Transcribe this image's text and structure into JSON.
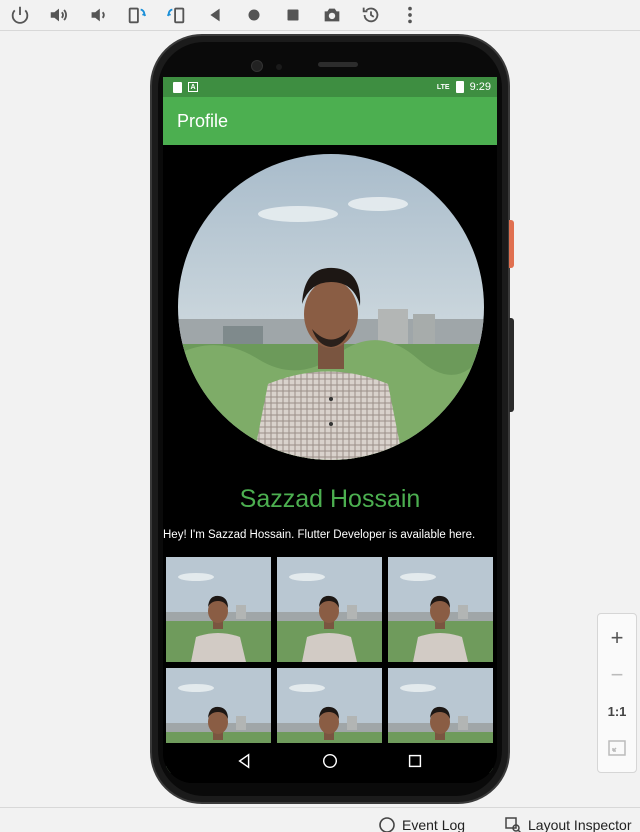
{
  "toolbar": {
    "buttons": [
      "power-icon",
      "volume-up-icon",
      "volume-down-icon",
      "rotate-left-icon",
      "rotate-right-icon",
      "back-icon",
      "home-icon",
      "overview-icon",
      "screenshot-icon",
      "snapshot-icon",
      "more-icon"
    ]
  },
  "status_bar": {
    "time": "9:29",
    "network": "LTE"
  },
  "app_bar": {
    "title": "Profile"
  },
  "profile": {
    "name": "Sazzad Hossain",
    "bio": "Hey! I'm Sazzad Hossain. Flutter Developer is available here."
  },
  "gallery": {
    "count": 6
  },
  "zoom": {
    "zoom_in": "+",
    "zoom_out": "−",
    "ratio": "1:1"
  },
  "bottom_tabs": {
    "event_log": "Event Log",
    "layout_inspector": "Layout Inspector"
  },
  "colors": {
    "accent": "#4caf50",
    "status_bar": "#3e8e41",
    "screen_bg": "#000000"
  }
}
